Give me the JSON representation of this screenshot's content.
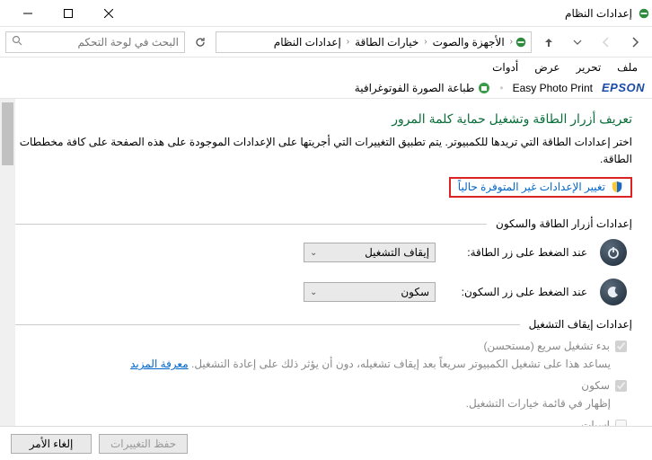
{
  "window": {
    "title": "إعدادات النظام"
  },
  "breadcrumb": {
    "items": [
      "الأجهزة والصوت",
      "خيارات الطاقة",
      "إعدادات النظام"
    ]
  },
  "search": {
    "placeholder": "البحث في لوحة التحكم"
  },
  "menu": {
    "file": "ملف",
    "edit": "تحرير",
    "view": "عرض",
    "tools": "أدوات"
  },
  "epson": {
    "logo": "EPSON",
    "easy": "Easy Photo Print",
    "photo": "طباعة الصورة الفوتوغرافية"
  },
  "page": {
    "title": "تعريف أزرار الطاقة وتشغيل حماية كلمة المرور",
    "desc": "اختر إعدادات الطاقة التي تريدها للكمبيوتر. يتم تطبيق التغييرات التي أجريتها على الإعدادات الموجودة على هذه الصفحة على كافة مخططات الطاقة.",
    "change_link": "تغيير الإعدادات غير المتوفرة حالياً"
  },
  "section1": {
    "header": "إعدادات أزرار الطاقة والسكون",
    "power_label": "عند الضغط على زر الطاقة:",
    "power_value": "إيقاف التشغيل",
    "sleep_label": "عند الضغط على زر السكون:",
    "sleep_value": "سكون"
  },
  "section2": {
    "header": "إعدادات إيقاف التشغيل",
    "fast_start": "بدء تشغيل سريع (مستحسن)",
    "fast_desc": "يساعد هذا على تشغيل الكمبيوتر سريعاً بعد إيقاف تشغيله، دون أن يؤثر ذلك على إعادة التشغيل.",
    "learn_more": "معرفة المزيد",
    "sleep": "سكون",
    "sleep_desc": "إظهار في قائمة خيارات التشغيل.",
    "hibernate": "إسبات"
  },
  "footer": {
    "save": "حفظ التغييرات",
    "cancel": "إلغاء الأمر"
  }
}
